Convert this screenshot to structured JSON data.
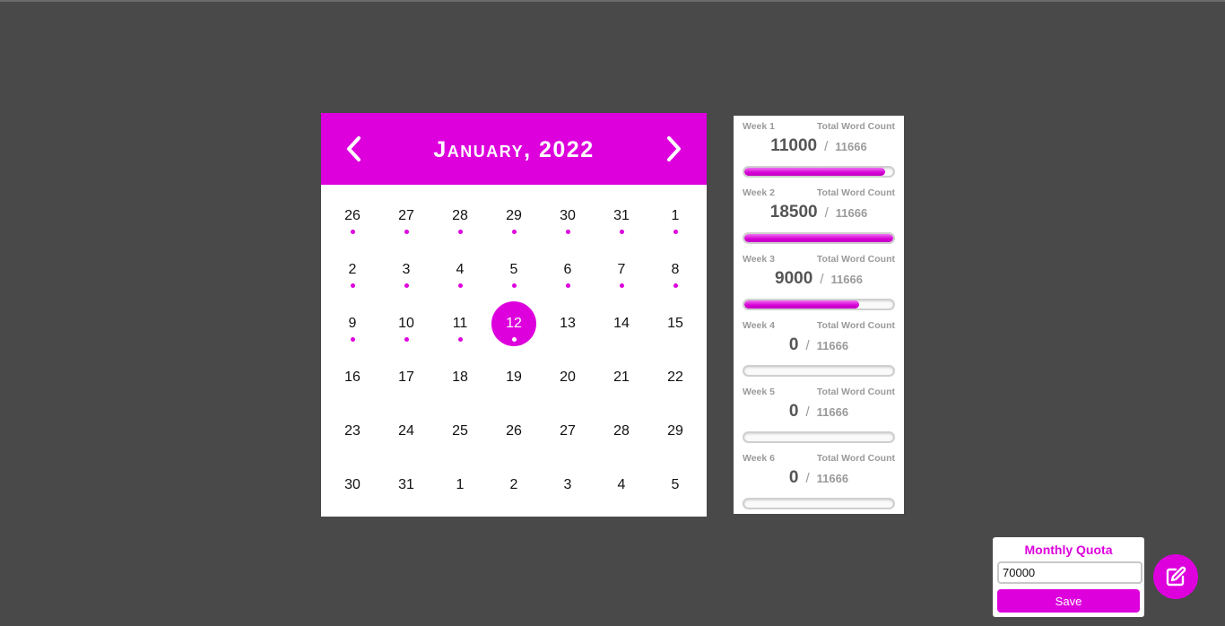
{
  "calendar": {
    "month_title": "January, 2022",
    "prev_icon": "chevron-left-icon",
    "next_icon": "chevron-right-icon",
    "accent": "#dd00dd",
    "days": [
      {
        "n": "26",
        "dot": true
      },
      {
        "n": "27",
        "dot": true
      },
      {
        "n": "28",
        "dot": true
      },
      {
        "n": "29",
        "dot": true
      },
      {
        "n": "30",
        "dot": true
      },
      {
        "n": "31",
        "dot": true
      },
      {
        "n": "1",
        "dot": true
      },
      {
        "n": "2",
        "dot": true
      },
      {
        "n": "3",
        "dot": true
      },
      {
        "n": "4",
        "dot": true
      },
      {
        "n": "5",
        "dot": true
      },
      {
        "n": "6",
        "dot": true
      },
      {
        "n": "7",
        "dot": true
      },
      {
        "n": "8",
        "dot": true
      },
      {
        "n": "9",
        "dot": true
      },
      {
        "n": "10",
        "dot": true
      },
      {
        "n": "11",
        "dot": true
      },
      {
        "n": "12",
        "dot": true,
        "today": true
      },
      {
        "n": "13"
      },
      {
        "n": "14"
      },
      {
        "n": "15"
      },
      {
        "n": "16"
      },
      {
        "n": "17"
      },
      {
        "n": "18"
      },
      {
        "n": "19"
      },
      {
        "n": "20"
      },
      {
        "n": "21"
      },
      {
        "n": "22"
      },
      {
        "n": "23"
      },
      {
        "n": "24"
      },
      {
        "n": "25"
      },
      {
        "n": "26"
      },
      {
        "n": "27"
      },
      {
        "n": "28"
      },
      {
        "n": "29"
      },
      {
        "n": "30"
      },
      {
        "n": "31"
      },
      {
        "n": "1"
      },
      {
        "n": "2"
      },
      {
        "n": "3"
      },
      {
        "n": "4"
      },
      {
        "n": "5"
      }
    ]
  },
  "weeks": [
    {
      "label": "Week 1",
      "total_label": "Total Word Count",
      "count": "11000",
      "separator": "/",
      "target": "11666",
      "progress": 0.943
    },
    {
      "label": "Week 2",
      "total_label": "Total Word Count",
      "count": "18500",
      "separator": "/",
      "target": "11666",
      "progress": 1.0
    },
    {
      "label": "Week 3",
      "total_label": "Total Word Count",
      "count": "9000",
      "separator": "/",
      "target": "11666",
      "progress": 0.771
    },
    {
      "label": "Week 4",
      "total_label": "Total Word Count",
      "count": "0",
      "separator": "/",
      "target": "11666",
      "progress": 0
    },
    {
      "label": "Week 5",
      "total_label": "Total Word Count",
      "count": "0",
      "separator": "/",
      "target": "11666",
      "progress": 0
    },
    {
      "label": "Week 6",
      "total_label": "Total Word Count",
      "count": "0",
      "separator": "/",
      "target": "11666",
      "progress": 0
    }
  ],
  "quota": {
    "title": "Monthly Quota",
    "value": "70000",
    "save_label": "Save"
  },
  "fab": {
    "icon": "edit-icon"
  }
}
